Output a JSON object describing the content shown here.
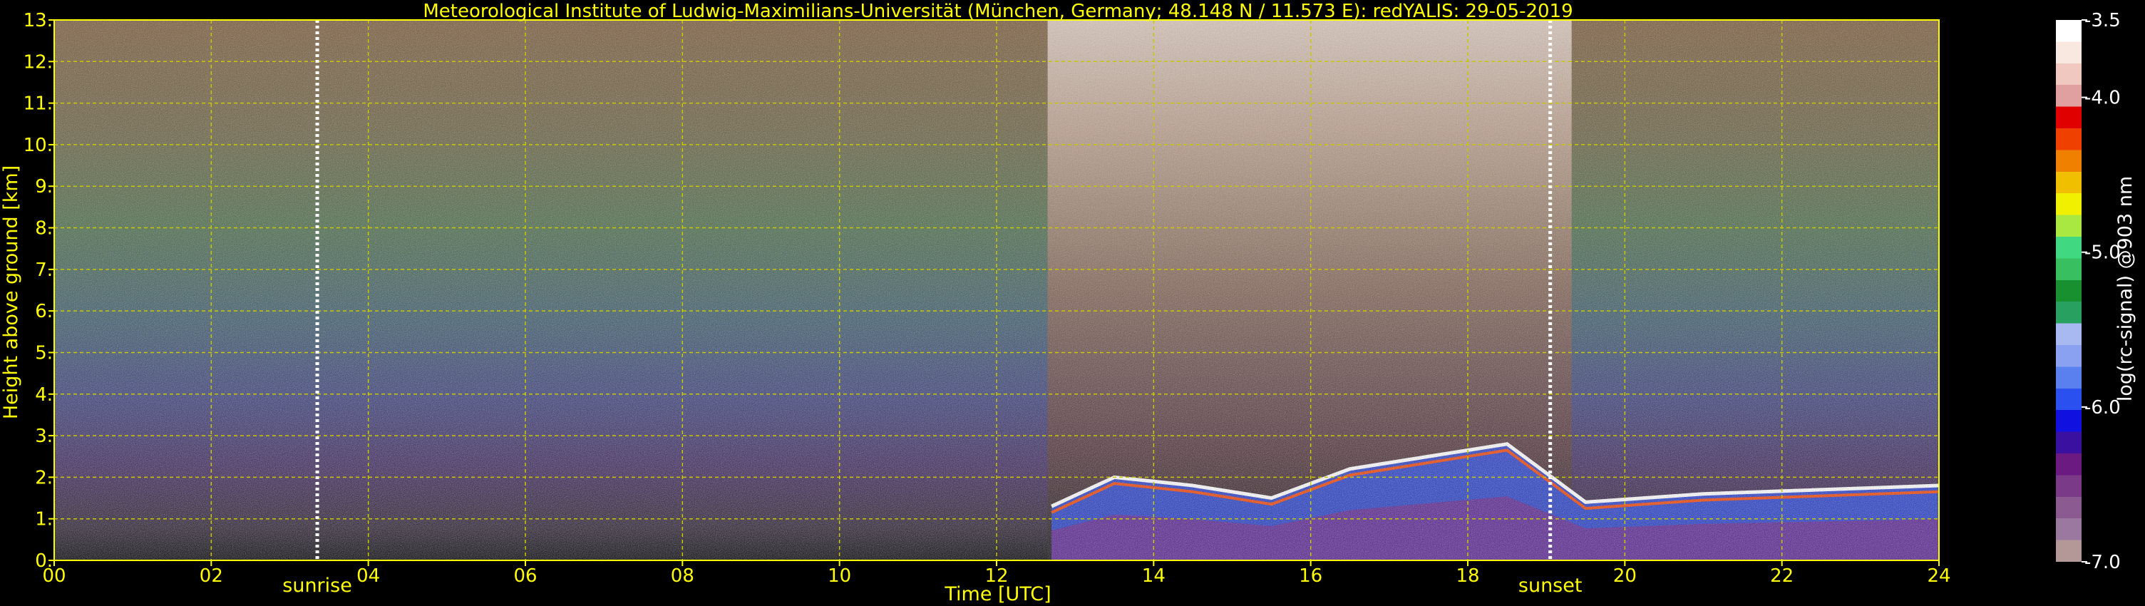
{
  "chart_data": {
    "type": "heatmap",
    "title": "Meteorological Institute of Ludwig-Maximilians-Universität (München, Germany; 48.148 N / 11.573 E):    redYALIS: 29-05-2019",
    "xlabel": "Time [UTC]",
    "ylabel": "Height above ground [km]",
    "x_ticks": [
      "00",
      "02",
      "04",
      "06",
      "08",
      "10",
      "12",
      "14",
      "16",
      "18",
      "20",
      "22",
      "24"
    ],
    "y_ticks": [
      "0.",
      "1.",
      "2.",
      "3.",
      "4.",
      "5.",
      "6.",
      "7.",
      "8.",
      "9.",
      "10.",
      "11.",
      "12.",
      "13."
    ],
    "xlim": [
      0,
      24
    ],
    "ylim": [
      0,
      13
    ],
    "grid": true,
    "annotations": [
      {
        "label": "sunrise",
        "x": 3.35
      },
      {
        "label": "sunset",
        "x": 19.05
      }
    ],
    "colorbar": {
      "label": "log(rc-signal) @903 nm",
      "range": [
        -7.0,
        -3.5
      ],
      "ticks": [
        "-3.5",
        "-4.0",
        "-5.0",
        "-6.0",
        "-7.0"
      ],
      "tick_values": [
        -3.5,
        -4.0,
        -5.0,
        -6.0,
        -7.0
      ],
      "colors": [
        "#b49898",
        "#9a78a0",
        "#8a5a90",
        "#7a3a88",
        "#6a1a80",
        "#3a10a0",
        "#1010e0",
        "#2a50f0",
        "#5a80f0",
        "#8aa0f0",
        "#a8b8f0",
        "#28a060",
        "#189030",
        "#38c060",
        "#40d880",
        "#a8e840",
        "#f0f000",
        "#f0c000",
        "#f08000",
        "#f04000",
        "#e00000",
        "#e0a0a0",
        "#f0c8c0",
        "#f8e8e0",
        "#ffffff"
      ]
    },
    "features": {
      "cloud_onset_time": 12.65,
      "boundary_layer_top_km": [
        {
          "x": 12.7,
          "y": 1.3
        },
        {
          "x": 13.5,
          "y": 2.0
        },
        {
          "x": 14.5,
          "y": 1.8
        },
        {
          "x": 15.5,
          "y": 1.5
        },
        {
          "x": 16.5,
          "y": 2.2
        },
        {
          "x": 17.5,
          "y": 2.5
        },
        {
          "x": 18.5,
          "y": 2.8
        },
        {
          "x": 19.5,
          "y": 1.4
        },
        {
          "x": 21.0,
          "y": 1.6
        },
        {
          "x": 24.0,
          "y": 1.8
        }
      ]
    },
    "colors": {
      "axis": "#ffff00",
      "grid": "#c8c800",
      "background": "#000000"
    }
  }
}
